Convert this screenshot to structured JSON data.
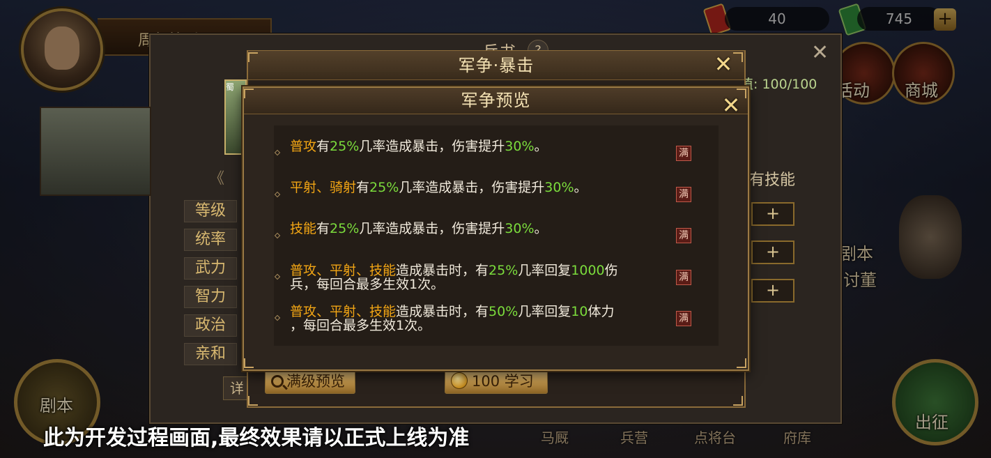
{
  "top": {
    "title_plate": "周年快乐",
    "resource1_value": "40",
    "resource2_value": "745",
    "plus_label": "+",
    "activity_label": "活动",
    "shop_label": "商城"
  },
  "right_side": {
    "script_label": "剧本",
    "quest_label": "讨董"
  },
  "left_side": {
    "script_label": "剧本"
  },
  "bottom": {
    "watermark": "此为开发过程画面,最终效果请以正式上线为准",
    "nav": [
      "马厩",
      "兵营",
      "点将台",
      "府库"
    ],
    "march_label": "出征"
  },
  "panel_bingshu": {
    "title": "兵书",
    "help": "?",
    "close": "✕",
    "exp_label": "值: 100/100",
    "skills_header": "有技能",
    "stats": [
      "等级",
      "统率",
      "武力",
      "智力",
      "政治",
      "亲和"
    ],
    "slot_plus": "+",
    "detail_label": "详",
    "portrait_tag": "蜀",
    "nav_left": "《"
  },
  "panel_skill": {
    "title": "军争·暴击",
    "close": "✕",
    "full_preview_button": "满级预览",
    "learn_cost": "100",
    "learn_label": "学习"
  },
  "panel_preview": {
    "title": "军争预览",
    "close": "✕",
    "badge_full": "满",
    "effects": [
      {
        "line1": [
          {
            "t": "普攻",
            "c": "gold"
          },
          {
            "t": "有",
            "c": "white"
          },
          {
            "t": "25%",
            "c": "green"
          },
          {
            "t": "几率造成暴击，伤害提升",
            "c": "white"
          },
          {
            "t": "30%",
            "c": "green"
          },
          {
            "t": "。",
            "c": "white"
          }
        ],
        "line2": []
      },
      {
        "line1": [
          {
            "t": "平射、骑射",
            "c": "gold"
          },
          {
            "t": "有",
            "c": "white"
          },
          {
            "t": "25%",
            "c": "green"
          },
          {
            "t": "几率造成暴击，伤害提升",
            "c": "white"
          },
          {
            "t": "30%",
            "c": "green"
          },
          {
            "t": "。",
            "c": "white"
          }
        ],
        "line2": []
      },
      {
        "line1": [
          {
            "t": "技能",
            "c": "gold"
          },
          {
            "t": "有",
            "c": "white"
          },
          {
            "t": "25%",
            "c": "green"
          },
          {
            "t": "几率造成暴击，伤害提升",
            "c": "white"
          },
          {
            "t": "30%",
            "c": "green"
          },
          {
            "t": "。",
            "c": "white"
          }
        ],
        "line2": []
      },
      {
        "line1": [
          {
            "t": "普攻、平射、技能",
            "c": "gold"
          },
          {
            "t": "造成暴击时，有",
            "c": "white"
          },
          {
            "t": "25%",
            "c": "green"
          },
          {
            "t": "几率回复",
            "c": "white"
          },
          {
            "t": "1000",
            "c": "green"
          },
          {
            "t": "伤",
            "c": "white"
          }
        ],
        "line2": [
          {
            "t": "兵，每回合最多生效1次。",
            "c": "white"
          }
        ]
      },
      {
        "line1": [
          {
            "t": "普攻、平射、技能",
            "c": "gold"
          },
          {
            "t": "造成暴击时，有",
            "c": "white"
          },
          {
            "t": "50%",
            "c": "green"
          },
          {
            "t": "几率回复",
            "c": "white"
          },
          {
            "t": "10",
            "c": "green"
          },
          {
            "t": "体力",
            "c": "white"
          }
        ],
        "line2": [
          {
            "t": "，每回合最多生效1次。",
            "c": "white"
          }
        ]
      }
    ]
  },
  "colors": {
    "gold_text": "#f3a614",
    "green_text": "#7bdc3c",
    "white_text": "#f1eadc"
  }
}
